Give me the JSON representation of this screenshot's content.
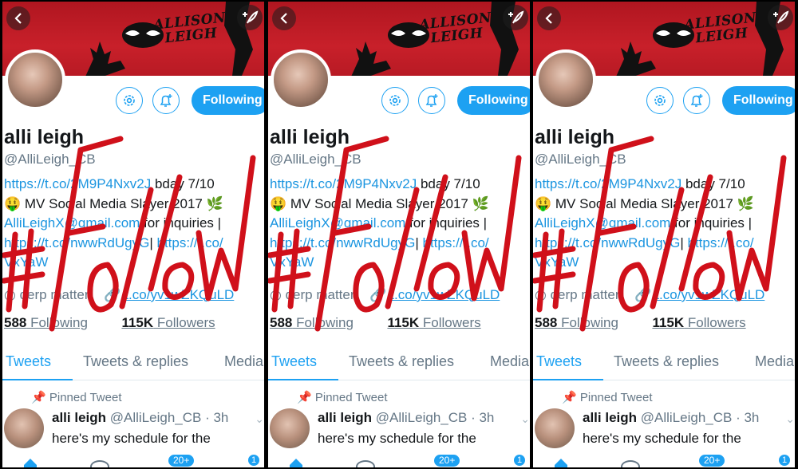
{
  "banner": {
    "signature_line1": "ALLISON",
    "signature_line2": "LEIGH"
  },
  "profile": {
    "name": "alli leigh",
    "handle": "@AlliLeigh_CB",
    "following_button": "Following",
    "bio_lines": {
      "line1_link": "https://t.co/2M9P4Nxv2J",
      "line1_text": " bday 7/10",
      "line2": "🤑 MV Social Media Slayer 2017 🌿",
      "line3_link": "AlliLeighX@gmail.com",
      "line3_text": " for inquiries |",
      "line4_link1": "https://t.co/nwwRdUgyG",
      "line4_sep": "| ",
      "line4_link2": "https://t.co/",
      "line5_link": "VxYaW"
    },
    "location": "derp matter",
    "website": "t.co/yv1wZKQuLD",
    "following_count": "588",
    "following_label": " Following",
    "followers_count": "115K",
    "followers_label": " Followers"
  },
  "tabs": [
    "Tweets",
    "Tweets & replies",
    "Media"
  ],
  "pinned": {
    "label": "Pinned Tweet",
    "author": "alli leigh",
    "handle_time": " @AlliLeigh_CB · 3h",
    "text": "here's my schedule for the"
  },
  "nav": {
    "notifications_badge": "20+",
    "messages_badge": "1"
  },
  "overlay_text": "#Follow",
  "colors": {
    "twitter_blue": "#1da1f2",
    "banner_red": "#c8202a",
    "overlay_red": "#d0101a"
  }
}
